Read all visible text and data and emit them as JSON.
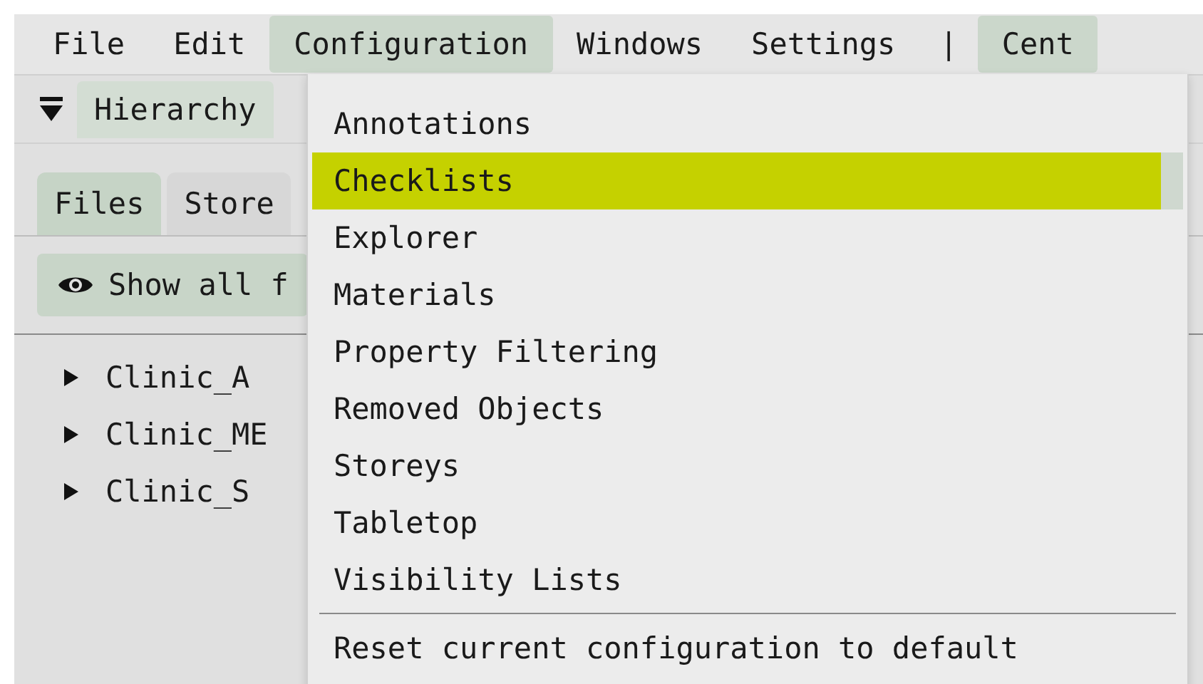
{
  "menu_bar": [
    {
      "label": "File",
      "kind": "item",
      "selected": false
    },
    {
      "label": "Edit",
      "kind": "item",
      "selected": false
    },
    {
      "label": "Configuration",
      "kind": "item",
      "selected": true
    },
    {
      "label": "Windows",
      "kind": "item",
      "selected": false
    },
    {
      "label": "Settings",
      "kind": "item",
      "selected": false
    },
    {
      "label": "|",
      "kind": "separator"
    },
    {
      "label": "Cent",
      "kind": "item",
      "selected": true
    }
  ],
  "panel_header": {
    "title": "Hierarchy"
  },
  "tabs": [
    {
      "label": "Files",
      "selected": true
    },
    {
      "label": "Store",
      "selected": false
    }
  ],
  "toolbar": [
    {
      "label": "Show all f"
    }
  ],
  "tree": [
    {
      "label": "Clinic_A",
      "expanded": false
    },
    {
      "label": "Clinic_ME",
      "expanded": false
    },
    {
      "label": "Clinic_S",
      "expanded": false
    }
  ],
  "dropdown": {
    "items": [
      {
        "label": "Annotations",
        "selected": false
      },
      {
        "label": "Checklists",
        "selected": true
      },
      {
        "label": "Explorer",
        "selected": false
      },
      {
        "label": "Materials",
        "selected": false
      },
      {
        "label": "Property Filtering",
        "selected": false
      },
      {
        "label": "Removed Objects",
        "selected": false
      },
      {
        "label": "Storeys",
        "selected": false
      },
      {
        "label": "Tabletop",
        "selected": false
      },
      {
        "label": "Visibility Lists",
        "selected": false
      }
    ],
    "footer_items": [
      {
        "label": "Reset current configuration to default",
        "selected": false
      }
    ]
  }
}
